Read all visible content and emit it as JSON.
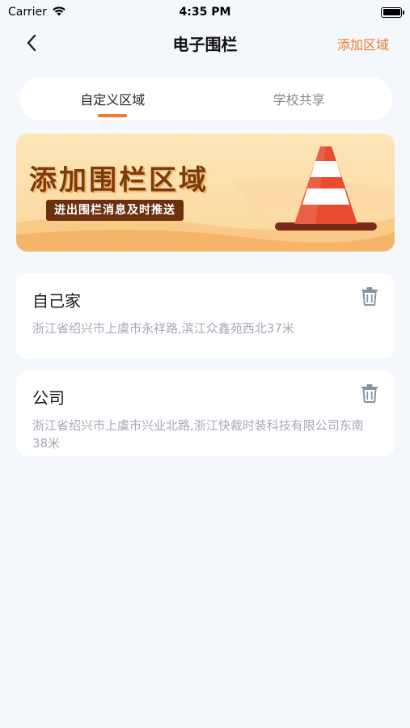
{
  "status_bar": {
    "carrier": "Carrier",
    "time": "4:35 PM"
  },
  "nav": {
    "title": "电子围栏",
    "action_label": "添加区域"
  },
  "tabs": [
    {
      "label": "自定义区域",
      "active": true
    },
    {
      "label": "学校共享",
      "active": false
    }
  ],
  "banner": {
    "title": "添加围栏区域",
    "subtitle": "进出围栏消息及时推送"
  },
  "fences": [
    {
      "name": "自己家",
      "address": "浙江省绍兴市上虞市永祥路,滨江众鑫苑西北37米"
    },
    {
      "name": "公司",
      "address": "浙江省绍兴市上虞市兴业北路,浙江快裁时装科技有限公司东南38米"
    }
  ],
  "colors": {
    "accent": "#f07a2c",
    "background": "#f4f7fb",
    "banner_dark": "#6b3010"
  }
}
